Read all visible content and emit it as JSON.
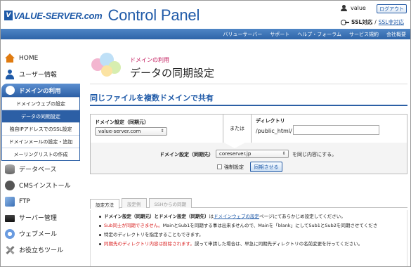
{
  "header": {
    "brand": "VALUE-SERVER.com",
    "logo_mark": "V",
    "title": "Control Panel",
    "user_name": "value",
    "logout_label": "ログアウト",
    "ssl_on_label": "SSL対応",
    "ssl_sep": "/",
    "ssl_off_label": "SSL非対応"
  },
  "nav": {
    "items": [
      "バリューサーバー",
      "サポート",
      "ヘルプ・フォーラム",
      "サービス規約",
      "会社概要"
    ]
  },
  "sidebar": {
    "items_top": [
      {
        "label": "HOME",
        "icon": "home-icon"
      },
      {
        "label": "ユーザー情報",
        "icon": "user-icon"
      }
    ],
    "domain_section": {
      "label": "ドメインの利用",
      "icon": "globe-icon",
      "subitems": [
        {
          "label": "ドメインウェブの設定",
          "active": false
        },
        {
          "label": "データの同期設定",
          "active": true
        },
        {
          "label": "独自IPアドレスでのSSL設定",
          "active": false
        },
        {
          "label": "ドメインメールの設定・追加",
          "active": false
        },
        {
          "label": "メーリングリストの作成",
          "active": false
        }
      ]
    },
    "items_bottom": [
      {
        "label": "データベース",
        "icon": "database-icon"
      },
      {
        "label": "CMSインストール",
        "icon": "wordpress-icon"
      },
      {
        "label": "FTP",
        "icon": "ftp-icon"
      },
      {
        "label": "サーバー管理",
        "icon": "server-icon"
      },
      {
        "label": "ウェブメール",
        "icon": "webmail-icon"
      },
      {
        "label": "お役立ちツール",
        "icon": "tools-icon"
      }
    ]
  },
  "page": {
    "category": "ドメインの利用",
    "title": "データの同期設定",
    "section_heading": "同じファイルを複数ドメインで共有"
  },
  "form": {
    "source_label": "ドメイン設定（同期元）",
    "source_value": "value-server.com",
    "or_label": "または",
    "directory_label": "ディレクトリ",
    "directory_prefix": "/public_html/",
    "directory_value": "",
    "target_label": "ドメイン設定（同期先）",
    "target_value": "coreserver.jp",
    "target_tail": "を同じ内容にする。",
    "force_label": "強制設定",
    "force_checked": false,
    "sync_button": "同期させる"
  },
  "tabs": [
    {
      "label": "設定方法",
      "active": true
    },
    {
      "label": "設定例",
      "active": false
    },
    {
      "label": "SSHからの同期",
      "active": false
    }
  ],
  "notes": [
    {
      "b1": "ドメイン設定（同期元）とドメイン設定（同期先）",
      "t1": "は",
      "lk": "ドメインウェブの設定",
      "t2": "ページにてあらかじめ設定してください。"
    },
    {
      "red": "Sub同士が同期できません。",
      "t1": "MainとSub1を同期する事は出来ませんので、Mainを「blank」にしてSub1とSub2を同期させてくださ"
    },
    {
      "t1": "特定のディレクトリを指定することもできます。"
    },
    {
      "red": "同期先のディレクトリ内容は削除されます。",
      "t1": "誤って申請した場合は、早急に同期先ディレクトリの名前変更を行ってください。"
    }
  ],
  "colors": {
    "brand_blue": "#1f5aa8",
    "nav_blue": "#2e64a8",
    "active_blue": "#2c5fa5",
    "category_pink": "#c2185b",
    "warning_red": "#d92020"
  }
}
